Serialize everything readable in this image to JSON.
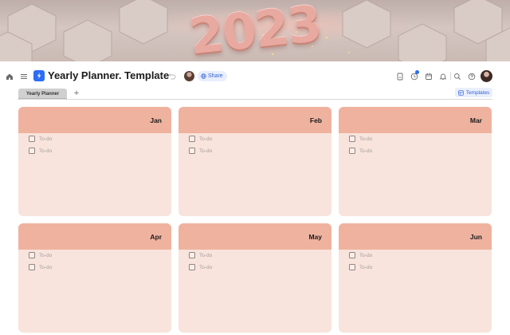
{
  "cover": {
    "text": "2023"
  },
  "toolbar": {
    "title": "Yearly Planner. Template",
    "share_label": "Share",
    "icons": [
      "home-icon",
      "menu-icon",
      "more-icon",
      "undo-icon",
      "doc-icon",
      "activity-icon",
      "calendar-icon",
      "bell-icon",
      "search-icon",
      "help-icon"
    ]
  },
  "tabs": {
    "items": [
      {
        "label": "Yearly Planner"
      }
    ],
    "add_label": "+",
    "templates_label": "Templates"
  },
  "months": [
    {
      "name": "Jan",
      "todos": [
        "To-do",
        "To-do"
      ]
    },
    {
      "name": "Feb",
      "todos": [
        "To-do",
        "To-do"
      ]
    },
    {
      "name": "Mar",
      "todos": [
        "To-do",
        "To-do"
      ]
    },
    {
      "name": "Apr",
      "todos": [
        "To-do",
        "To-do"
      ]
    },
    {
      "name": "May",
      "todos": [
        "To-do",
        "To-do"
      ]
    },
    {
      "name": "Jun",
      "todos": [
        "To-do",
        "To-do"
      ]
    }
  ],
  "colors": {
    "accent": "#2d6df6",
    "card_header": "#efb29f",
    "card_body": "#f8e4dc"
  }
}
